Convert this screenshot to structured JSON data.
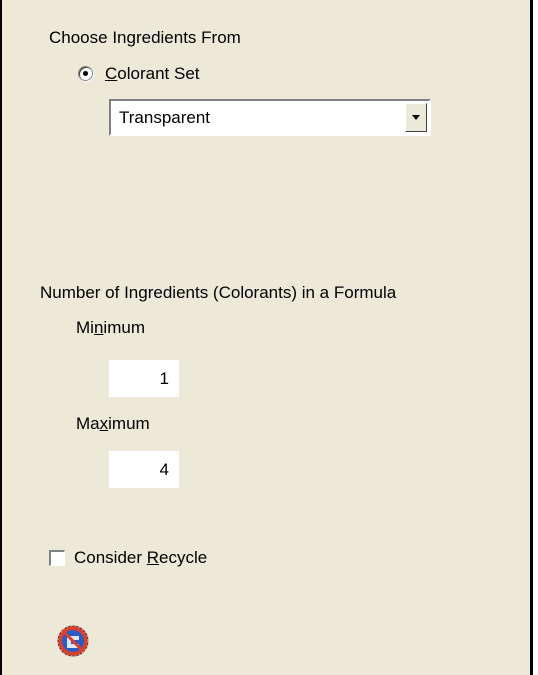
{
  "ingredients_source": {
    "heading": "Choose Ingredients From",
    "radio_label_mnemonic": "C",
    "radio_label_rest": "olorant Set",
    "radio_selected": true,
    "colorant_set_value": "Transparent"
  },
  "ingredient_count": {
    "heading": "Number of Ingredients (Colorants) in a Formula",
    "minimum_label_pre": "Mi",
    "minimum_label_mnemonic": "n",
    "minimum_label_post": "imum",
    "minimum_value": "1",
    "maximum_label_pre": "Ma",
    "maximum_label_mnemonic": "x",
    "maximum_label_post": "imum",
    "maximum_value": "4"
  },
  "recycle": {
    "label_pre": "Consider ",
    "label_mnemonic": "R",
    "label_post": "ecycle",
    "checked": false
  },
  "icons": {
    "dropdown_arrow": "chevron-down-icon",
    "app_icon": "app-logo-icon"
  }
}
